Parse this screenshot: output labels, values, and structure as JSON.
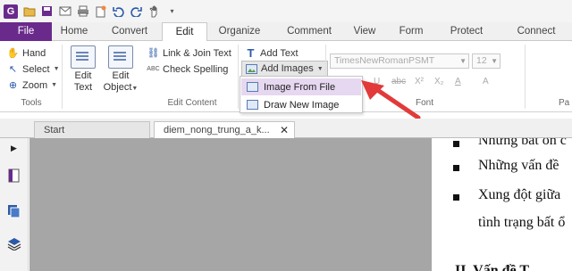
{
  "ribbon_tabs": [
    "File",
    "Home",
    "Convert",
    "Edit",
    "Organize",
    "Comment",
    "View",
    "Form",
    "Protect",
    "Connect"
  ],
  "tools_group": {
    "label": "Tools",
    "hand": "Hand",
    "select": "Select",
    "zoom": "Zoom"
  },
  "edit_content_group": {
    "label": "Edit Content",
    "edit_text_line1": "Edit",
    "edit_text_line2": "Text",
    "edit_object_line1": "Edit",
    "edit_object_line2": "Object",
    "link_join": "Link & Join Text",
    "check_spelling": "Check Spelling"
  },
  "add_group": {
    "add_text": "Add Text",
    "add_images": "Add Images"
  },
  "font_group": {
    "label": "Font",
    "font_name": "TimesNewRomanPSMT",
    "font_size": "12",
    "fmt_abc": "abc",
    "fmt_x2": "X²",
    "fmt_x2b": "X₂",
    "fmt_A": "A",
    "fmt_u": "U"
  },
  "add_images_menu": {
    "items": [
      "Image From File",
      "Draw New Image"
    ]
  },
  "cut_label": "Pa",
  "doc_tabs": [
    {
      "label": "Start"
    },
    {
      "label": "diem_nong_trung_a_k..."
    }
  ],
  "document_lines": [
    "Những bất ổn c",
    "Những vấn đề",
    "Xung đột giữa",
    "tình trạng bất ổ",
    "II. Vấn đề T..."
  ],
  "colors": {
    "brand": "#6a2a8c",
    "highlight": "#e6d8f0",
    "arrow": "#e23a3a",
    "workspace": "#a6a6a6"
  }
}
